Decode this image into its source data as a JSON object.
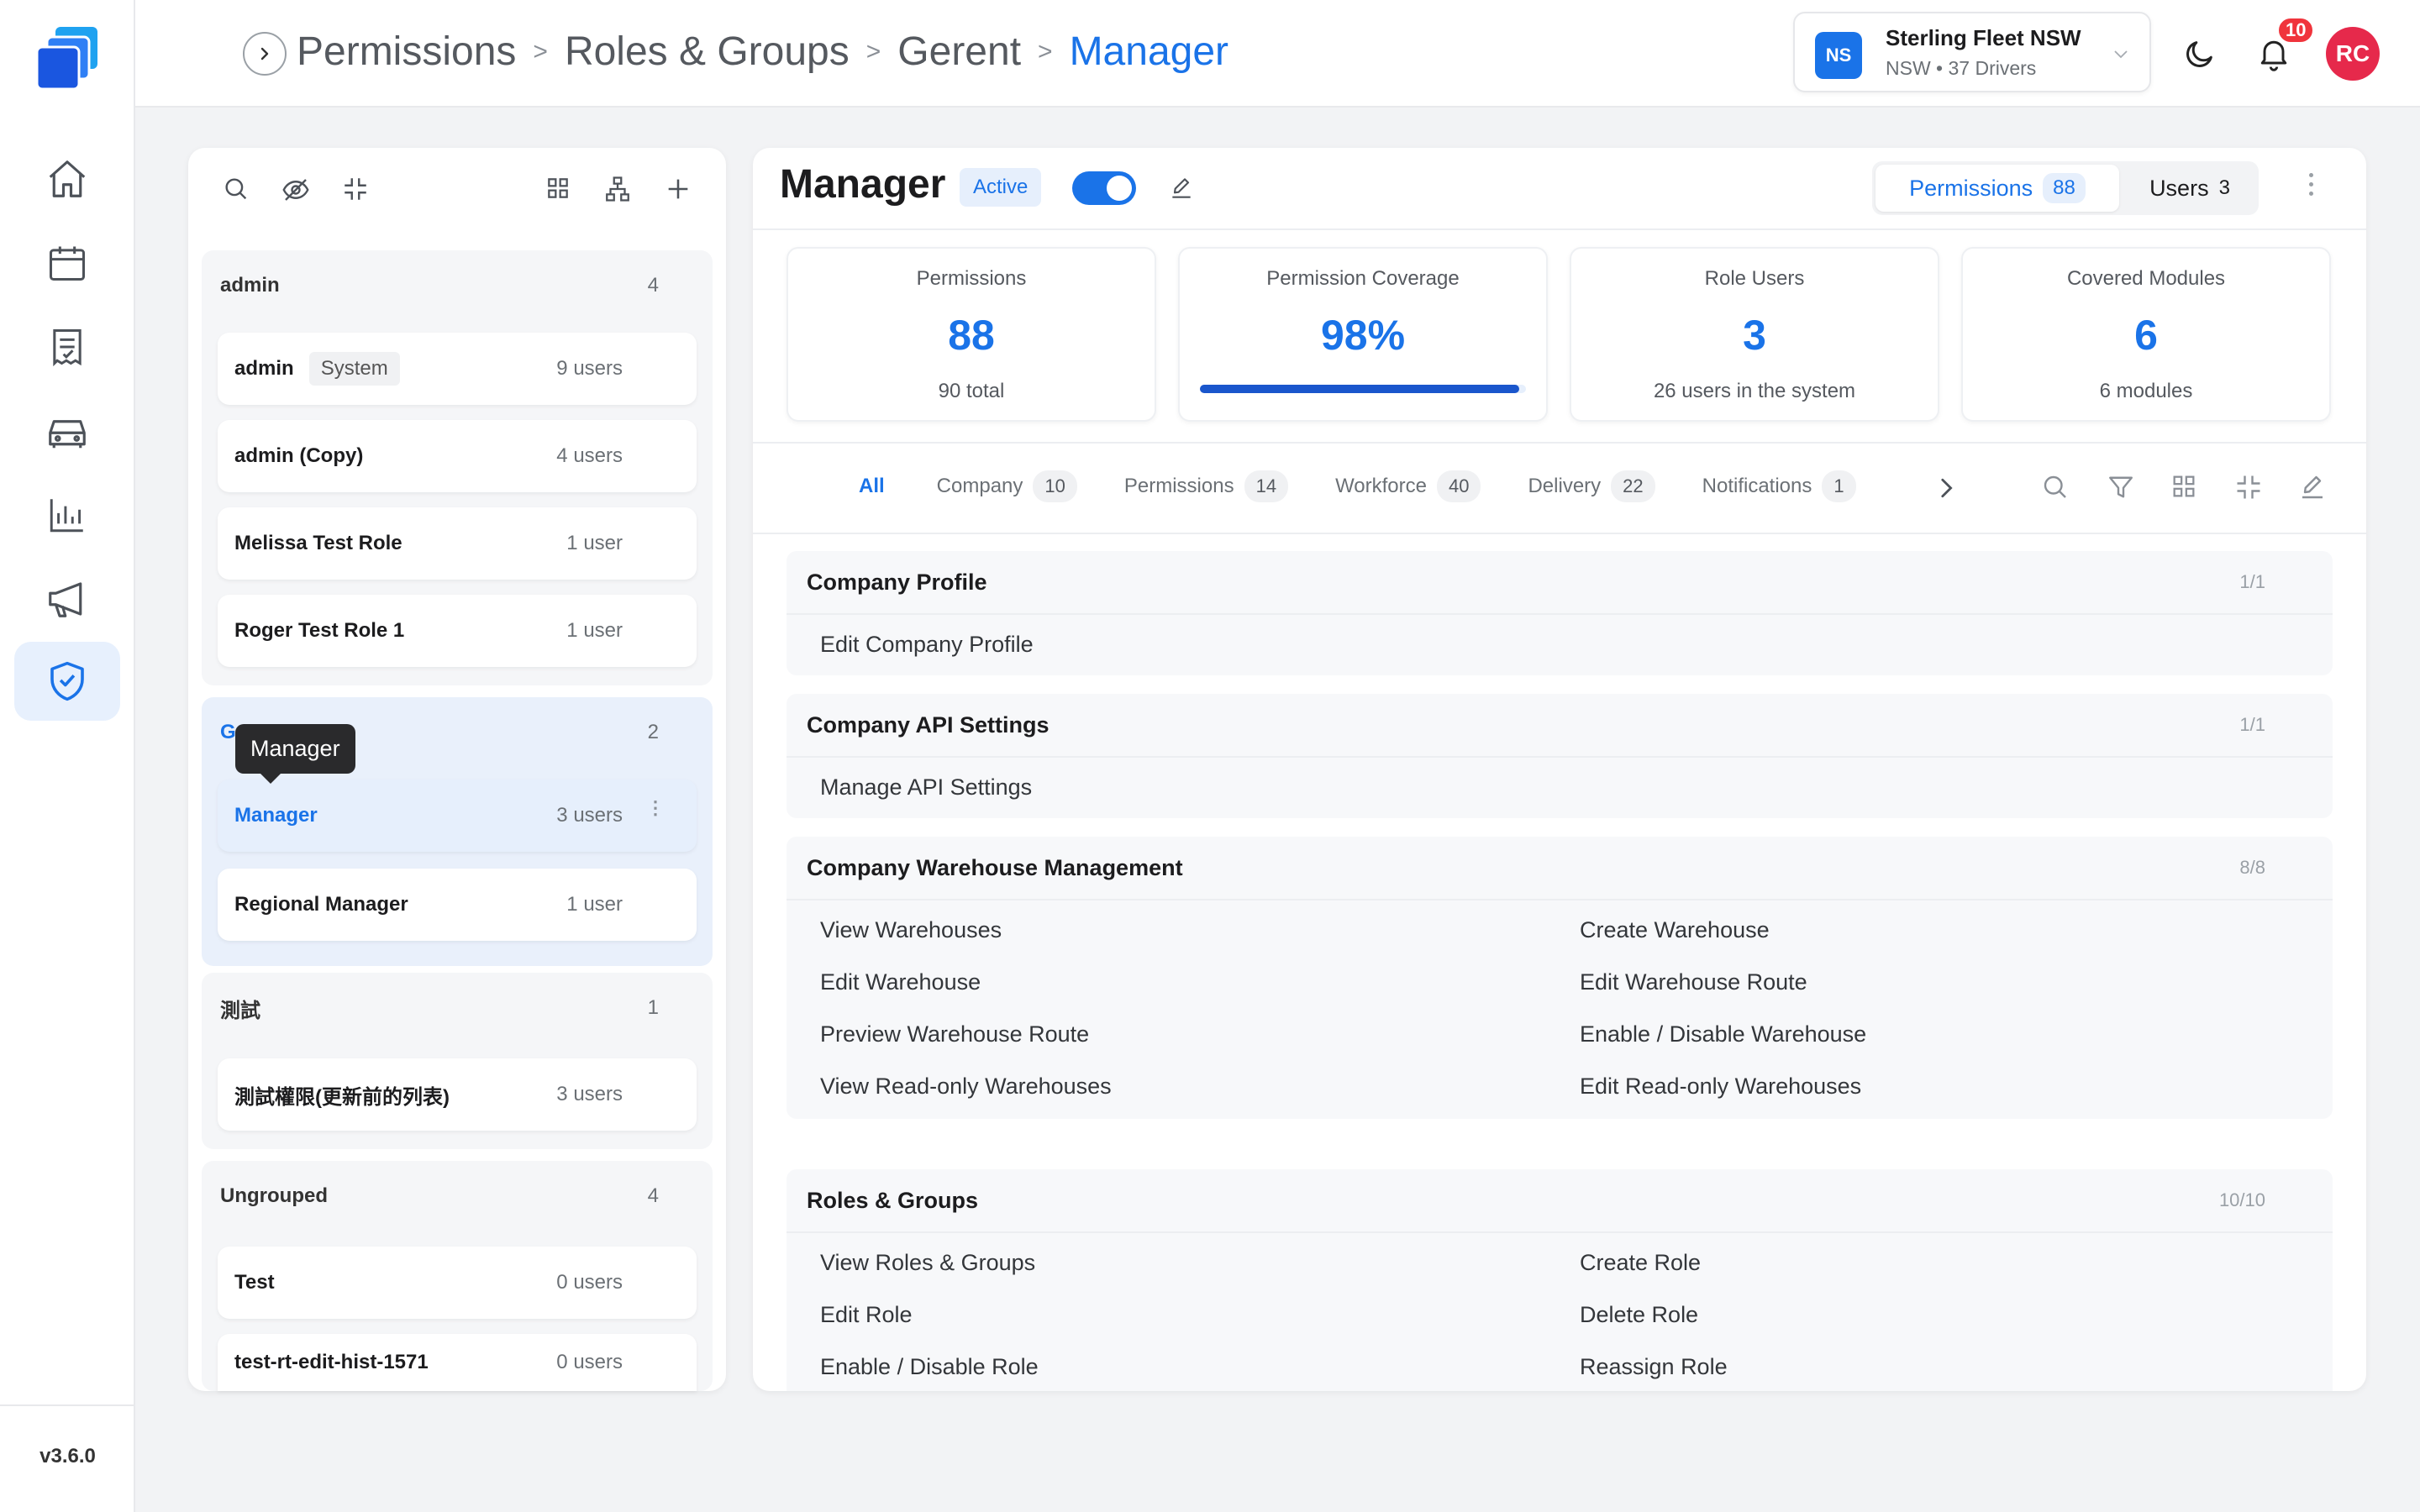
{
  "nav": {
    "icons": [
      "home-icon",
      "calendar-icon",
      "document-icon",
      "car-icon",
      "bar-chart-icon",
      "megaphone-icon",
      "shield-check-icon"
    ],
    "active": "shield-check-icon",
    "version": "v3.6.0"
  },
  "header": {
    "breadcrumb": [
      "Permissions",
      "Roles & Groups",
      "Gerent",
      "Manager"
    ],
    "breadcrumb_sep": ">",
    "org": {
      "badge": "NS",
      "name": "Sterling Fleet NSW",
      "sub": "NSW • 37 Drivers"
    },
    "notifications": "10",
    "avatar": "RC"
  },
  "groups": [
    {
      "name": "admin",
      "count": "4",
      "roles": [
        {
          "name": "admin",
          "tag": "System",
          "users": "9 users"
        },
        {
          "name": "admin (Copy)",
          "users": "4 users"
        },
        {
          "name": "Melissa Test Role",
          "users": "1 user"
        },
        {
          "name": "Roger Test Role 1",
          "users": "1 user"
        }
      ]
    },
    {
      "name": "Gerent",
      "count": "2",
      "roles": [
        {
          "name": "Manager",
          "users": "3 users"
        },
        {
          "name": "Regional Manager",
          "users": "1 user"
        }
      ]
    },
    {
      "name": "測試",
      "count": "1",
      "roles": [
        {
          "name": "測試權限(更新前的列表)",
          "users": "3 users"
        }
      ]
    },
    {
      "name": "Ungrouped",
      "count": "4",
      "roles": [
        {
          "name": "Test",
          "users": "0 users"
        },
        {
          "name": "test-rt-edit-hist-1571",
          "users": "0 users"
        }
      ]
    }
  ],
  "tooltip": "Manager",
  "role": {
    "title": "Manager",
    "status": "Active",
    "enabled": true,
    "tabs": [
      {
        "label": "Permissions",
        "count": "88"
      },
      {
        "label": "Users",
        "count": "3"
      }
    ]
  },
  "stats": [
    {
      "label": "Permissions",
      "value": "88",
      "sub": "90 total"
    },
    {
      "label": "Permission Coverage",
      "value": "98%",
      "progress": 0.98
    },
    {
      "label": "Role Users",
      "value": "3",
      "sub": "26 users in the system"
    },
    {
      "label": "Covered Modules",
      "value": "6",
      "sub": "6 modules"
    }
  ],
  "filters": [
    {
      "label": "All"
    },
    {
      "label": "Company",
      "count": "10"
    },
    {
      "label": "Permissions",
      "count": "14"
    },
    {
      "label": "Workforce",
      "count": "40"
    },
    {
      "label": "Delivery",
      "count": "22"
    },
    {
      "label": "Notifications",
      "count": "1"
    }
  ],
  "sections": [
    {
      "title": "Company Profile",
      "count": "1/1",
      "perms": [
        "Edit Company Profile"
      ]
    },
    {
      "title": "Company API Settings",
      "count": "1/1",
      "perms": [
        "Manage API Settings"
      ]
    },
    {
      "title": "Company Warehouse Management",
      "count": "8/8",
      "perms": [
        "View Warehouses",
        "Create Warehouse",
        "Edit Warehouse",
        "Edit Warehouse Route",
        "Preview Warehouse Route",
        "Enable / Disable Warehouse",
        "View Read-only Warehouses",
        "Edit Read-only Warehouses"
      ]
    },
    {
      "title": "Roles & Groups",
      "count": "10/10",
      "perms": [
        "View Roles & Groups",
        "Create Role",
        "Edit Role",
        "Delete Role",
        "Enable / Disable Role",
        "Reassign Role"
      ]
    }
  ]
}
